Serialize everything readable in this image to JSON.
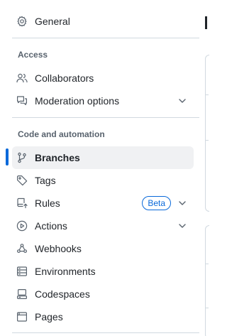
{
  "sidebar": {
    "top_items": [
      {
        "label": "General",
        "icon": "gear-icon"
      }
    ],
    "sections": [
      {
        "heading": "Access",
        "items": [
          {
            "label": "Collaborators",
            "icon": "people-icon"
          },
          {
            "label": "Moderation options",
            "icon": "comment-discussion-icon",
            "expandable": true
          }
        ]
      },
      {
        "heading": "Code and automation",
        "items": [
          {
            "label": "Branches",
            "icon": "git-branch-icon",
            "active": true
          },
          {
            "label": "Tags",
            "icon": "tag-icon"
          },
          {
            "label": "Rules",
            "icon": "repo-push-icon",
            "badge": "Beta",
            "expandable": true
          },
          {
            "label": "Actions",
            "icon": "play-icon",
            "expandable": true
          },
          {
            "label": "Webhooks",
            "icon": "webhook-icon"
          },
          {
            "label": "Environments",
            "icon": "server-icon"
          },
          {
            "label": "Codespaces",
            "icon": "codespaces-icon"
          },
          {
            "label": "Pages",
            "icon": "browser-icon"
          }
        ]
      }
    ]
  },
  "colors": {
    "accent": "#0969da",
    "active_bg": "#f0f1f3",
    "text": "#1f2328",
    "muted": "#59636e",
    "border": "#d1d9e0"
  }
}
